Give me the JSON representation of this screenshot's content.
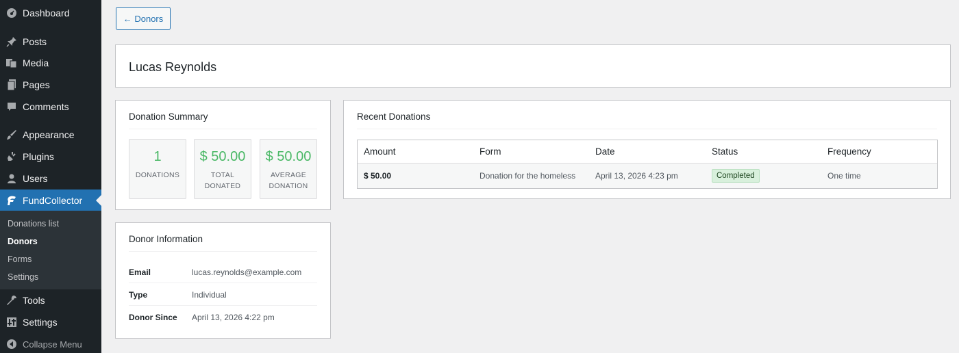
{
  "sidebar": {
    "items": [
      {
        "label": "Dashboard",
        "icon": "dashboard-icon"
      },
      {
        "label": "Posts",
        "icon": "pin-icon"
      },
      {
        "label": "Media",
        "icon": "media-icon"
      },
      {
        "label": "Pages",
        "icon": "pages-icon"
      },
      {
        "label": "Comments",
        "icon": "comment-icon"
      },
      {
        "label": "Appearance",
        "icon": "brush-icon"
      },
      {
        "label": "Plugins",
        "icon": "plugin-icon"
      },
      {
        "label": "Users",
        "icon": "user-icon"
      },
      {
        "label": "FundCollector",
        "icon": "fundcollector-icon"
      },
      {
        "label": "Tools",
        "icon": "wrench-icon"
      },
      {
        "label": "Settings",
        "icon": "settings-icon"
      }
    ],
    "submenu": [
      "Donations list",
      "Donors",
      "Forms",
      "Settings"
    ],
    "collapse_label": "Collapse Menu",
    "accent": "#2271b1"
  },
  "back_button": "← Donors",
  "donor_name": "Lucas Reynolds",
  "summary": {
    "title": "Donation Summary",
    "stats": [
      {
        "value": "1",
        "caption": "DONATIONS"
      },
      {
        "value": "$ 50.00",
        "caption": "TOTAL DONATED"
      },
      {
        "value": "$ 50.00",
        "caption": "AVERAGE DONATION"
      }
    ],
    "value_color": "#4ab866"
  },
  "donor_info": {
    "title": "Donor Information",
    "rows": [
      {
        "key": "Email",
        "value": "lucas.reynolds@example.com"
      },
      {
        "key": "Type",
        "value": "Individual"
      },
      {
        "key": "Donor Since",
        "value": "April 13, 2026 4:22 pm"
      }
    ]
  },
  "recent": {
    "title": "Recent Donations",
    "columns": [
      "Amount",
      "Form",
      "Date",
      "Status",
      "Frequency"
    ],
    "rows": [
      {
        "amount": "$ 50.00",
        "form": "Donation for the homeless",
        "date": "April 13, 2026 4:23 pm",
        "status": "Completed",
        "frequency": "One time"
      }
    ],
    "status_color": "#d8f0dc"
  }
}
